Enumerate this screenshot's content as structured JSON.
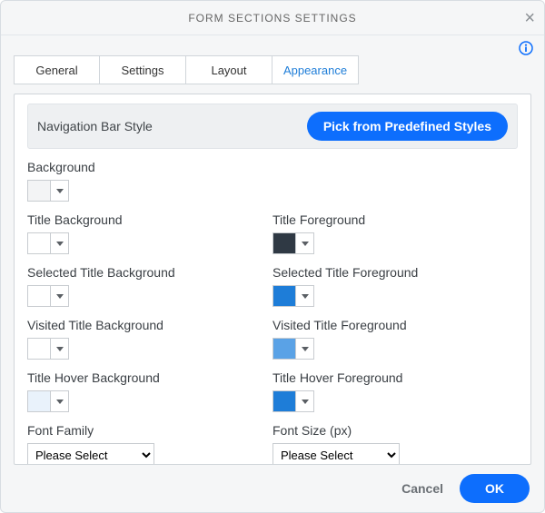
{
  "dialog": {
    "title": "FORM SECTIONS SETTINGS"
  },
  "tabs": {
    "general": "General",
    "settings": "Settings",
    "layout": "Layout",
    "appearance": "Appearance",
    "active": "appearance"
  },
  "section": {
    "nav_style_label": "Navigation Bar Style",
    "pick_label": "Pick from Predefined Styles"
  },
  "fields": {
    "background": {
      "label": "Background",
      "color": "#f3f4f5"
    },
    "title_bg": {
      "label": "Title Background",
      "color": "#ffffff"
    },
    "title_fg": {
      "label": "Title Foreground",
      "color": "#2f3944"
    },
    "sel_title_bg": {
      "label": "Selected Title Background",
      "color": "#ffffff"
    },
    "sel_title_fg": {
      "label": "Selected Title Foreground",
      "color": "#1e7dd8"
    },
    "vis_title_bg": {
      "label": "Visited Title Background",
      "color": "#ffffff"
    },
    "vis_title_fg": {
      "label": "Visited Title Foreground",
      "color": "#5aa2e6"
    },
    "hover_bg": {
      "label": "Title Hover Background",
      "color": "#e9f2fb"
    },
    "hover_fg": {
      "label": "Title Hover Foreground",
      "color": "#1e7dd8"
    },
    "font_family": {
      "label": "Font Family",
      "placeholder": "Please Select"
    },
    "font_size": {
      "label": "Font Size (px)",
      "placeholder": "Please Select"
    }
  },
  "footer": {
    "cancel": "Cancel",
    "ok": "OK"
  }
}
